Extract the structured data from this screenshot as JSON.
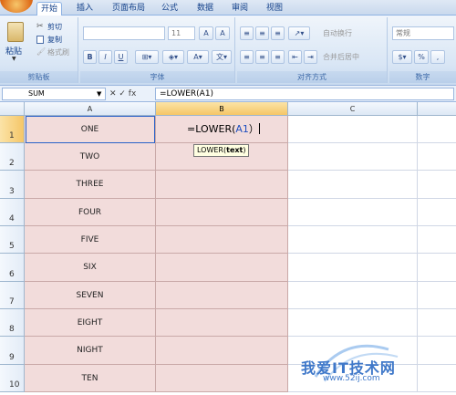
{
  "tabs": [
    "开始",
    "插入",
    "页面布局",
    "公式",
    "数据",
    "审阅",
    "视图"
  ],
  "ribbon": {
    "clipboard": {
      "paste": "粘贴",
      "cut": "剪切",
      "copy": "复制",
      "format_painter": "格式刷",
      "label": "剪贴板"
    },
    "font": {
      "font_name": "",
      "font_size": "11",
      "grow": "A",
      "shrink": "A",
      "bold": "B",
      "italic": "I",
      "underline": "U",
      "label": "字体"
    },
    "alignment": {
      "wrap": "自动换行",
      "merge": "合并后居中",
      "label": "对齐方式"
    },
    "number": {
      "format": "常规",
      "percent": "%",
      "label": "数字"
    }
  },
  "formula_bar": {
    "name_box": "SUM",
    "buttons": "✕ ✓ fx",
    "formula": "=LOWER(A1)"
  },
  "columns": [
    "A",
    "B",
    "C"
  ],
  "rows": [
    {
      "num": "1",
      "a": "ONE"
    },
    {
      "num": "2",
      "a": "TWO"
    },
    {
      "num": "3",
      "a": "THREE"
    },
    {
      "num": "4",
      "a": "FOUR"
    },
    {
      "num": "5",
      "a": "FIVE"
    },
    {
      "num": "6",
      "a": "SIX"
    },
    {
      "num": "7",
      "a": "SEVEN"
    },
    {
      "num": "8",
      "a": "EIGHT"
    },
    {
      "num": "9",
      "a": "NIGHT"
    },
    {
      "num": "10",
      "a": "TEN"
    }
  ],
  "edit_cell": {
    "prefix": "=LOWER(",
    "ref": "A1",
    "suffix": "）"
  },
  "tooltip": {
    "fn": "LOWER(",
    "arg": "text",
    "close": ")"
  },
  "watermark": {
    "text": "我爱IT技术网",
    "url": "www.52ij.com"
  }
}
